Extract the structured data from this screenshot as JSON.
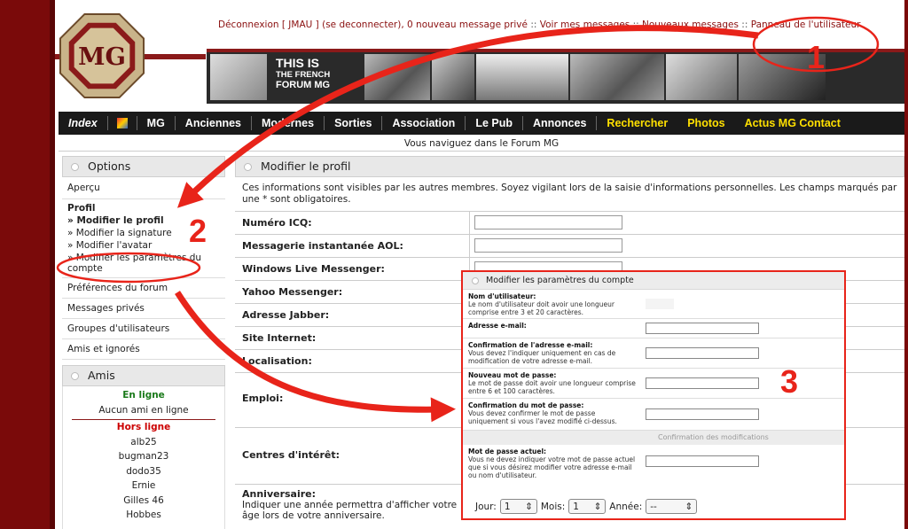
{
  "top_links": {
    "logout": "Déconnexion [ JMAU ] (se deconnecter)",
    "new_pm": "0 nouveau message privé",
    "view_messages": "Voir mes messages",
    "new_messages": "Nouveaux messages",
    "user_panel": "Panneau de l'utilisateur",
    "separator": "::"
  },
  "banner": {
    "line1": "THIS IS",
    "line2": "THE FRENCH",
    "line3": "FORUM MG"
  },
  "nav": {
    "index": "Index",
    "items": [
      "MG",
      "Anciennes",
      "Modernes",
      "Sorties",
      "Association",
      "Le Pub",
      "Annonces"
    ],
    "yellow_items": [
      "Rechercher",
      "Photos",
      "Actus MG Contact"
    ]
  },
  "breadcrumb": "Vous naviguez dans le Forum MG",
  "sidebar": {
    "options_title": "Options",
    "overview": "Aperçu",
    "profile_title": "Profil",
    "profile_items": [
      "» Modifier le profil",
      "» Modifier la signature",
      "» Modifier l'avatar",
      "» Modifier les paramètres du compte"
    ],
    "prefs": "Préférences du forum",
    "pm": "Messages privés",
    "groups": "Groupes d'utilisateurs",
    "friends_ignored": "Amis et ignorés",
    "friends_title": "Amis",
    "online_label": "En ligne",
    "no_friend_online": "Aucun ami en ligne",
    "offline_label": "Hors ligne",
    "offline_friends": [
      "alb25",
      "bugman23",
      "dodo35",
      "Ernie",
      "Gilles 46",
      "Hobbes"
    ]
  },
  "main": {
    "title": "Modifier le profil",
    "intro": "Ces informations sont visibles par les autres membres. Soyez vigilant lors de la saisie d'informations personnelles. Les champs marqués par une * sont obligatoires.",
    "fields": [
      "Numéro ICQ:",
      "Messagerie instantanée AOL:",
      "Windows Live Messenger:",
      "Yahoo Messenger:",
      "Adresse Jabber:",
      "Site Internet:",
      "Localisation:",
      "Emploi:",
      "Centres d'intérêt:"
    ],
    "birthday_label": "Anniversaire:",
    "birthday_help": "Indiquer une année permettra d'afficher votre âge lors de votre anniversaire.",
    "day_label": "Jour:",
    "day_value": "1",
    "month_label": "Mois:",
    "month_value": "1",
    "year_label": "Année:",
    "year_value": "--"
  },
  "popup": {
    "title": "Modifier les paramètres du compte",
    "username_title": "Nom d'utilisateur:",
    "username_help": "Le nom d'utilisateur doit avoir une longueur comprise entre 3 et 20 caractères.",
    "email_title": "Adresse e-mail:",
    "email_confirm_title": "Confirmation de l'adresse e-mail:",
    "email_confirm_help": "Vous devez l'indiquer uniquement en cas de modification de votre adresse e-mail.",
    "new_pw_title": "Nouveau mot de passe:",
    "new_pw_help": "Le mot de passe doit avoir une longueur comprise entre 6 et 100 caractères.",
    "confirm_pw_title": "Confirmation du mot de passe:",
    "confirm_pw_help": "Vous devez confirmer le mot de passe uniquement si vous l'avez modifié ci-dessus.",
    "confirm_section": "Confirmation des modifications",
    "current_pw_title": "Mot de passe actuel:",
    "current_pw_help": "Vous ne devez indiquer votre mot de passe actuel que si vous désirez modifier votre adresse e-mail ou nom d'utilisateur."
  },
  "annotations": [
    "1",
    "2",
    "3"
  ],
  "colors": {
    "annotation": "#e8241a",
    "background": "#7a0a0a",
    "nav_bar": "#1a1a1a",
    "nav_highlight": "#ffe000",
    "link": "#8a0f0f"
  }
}
